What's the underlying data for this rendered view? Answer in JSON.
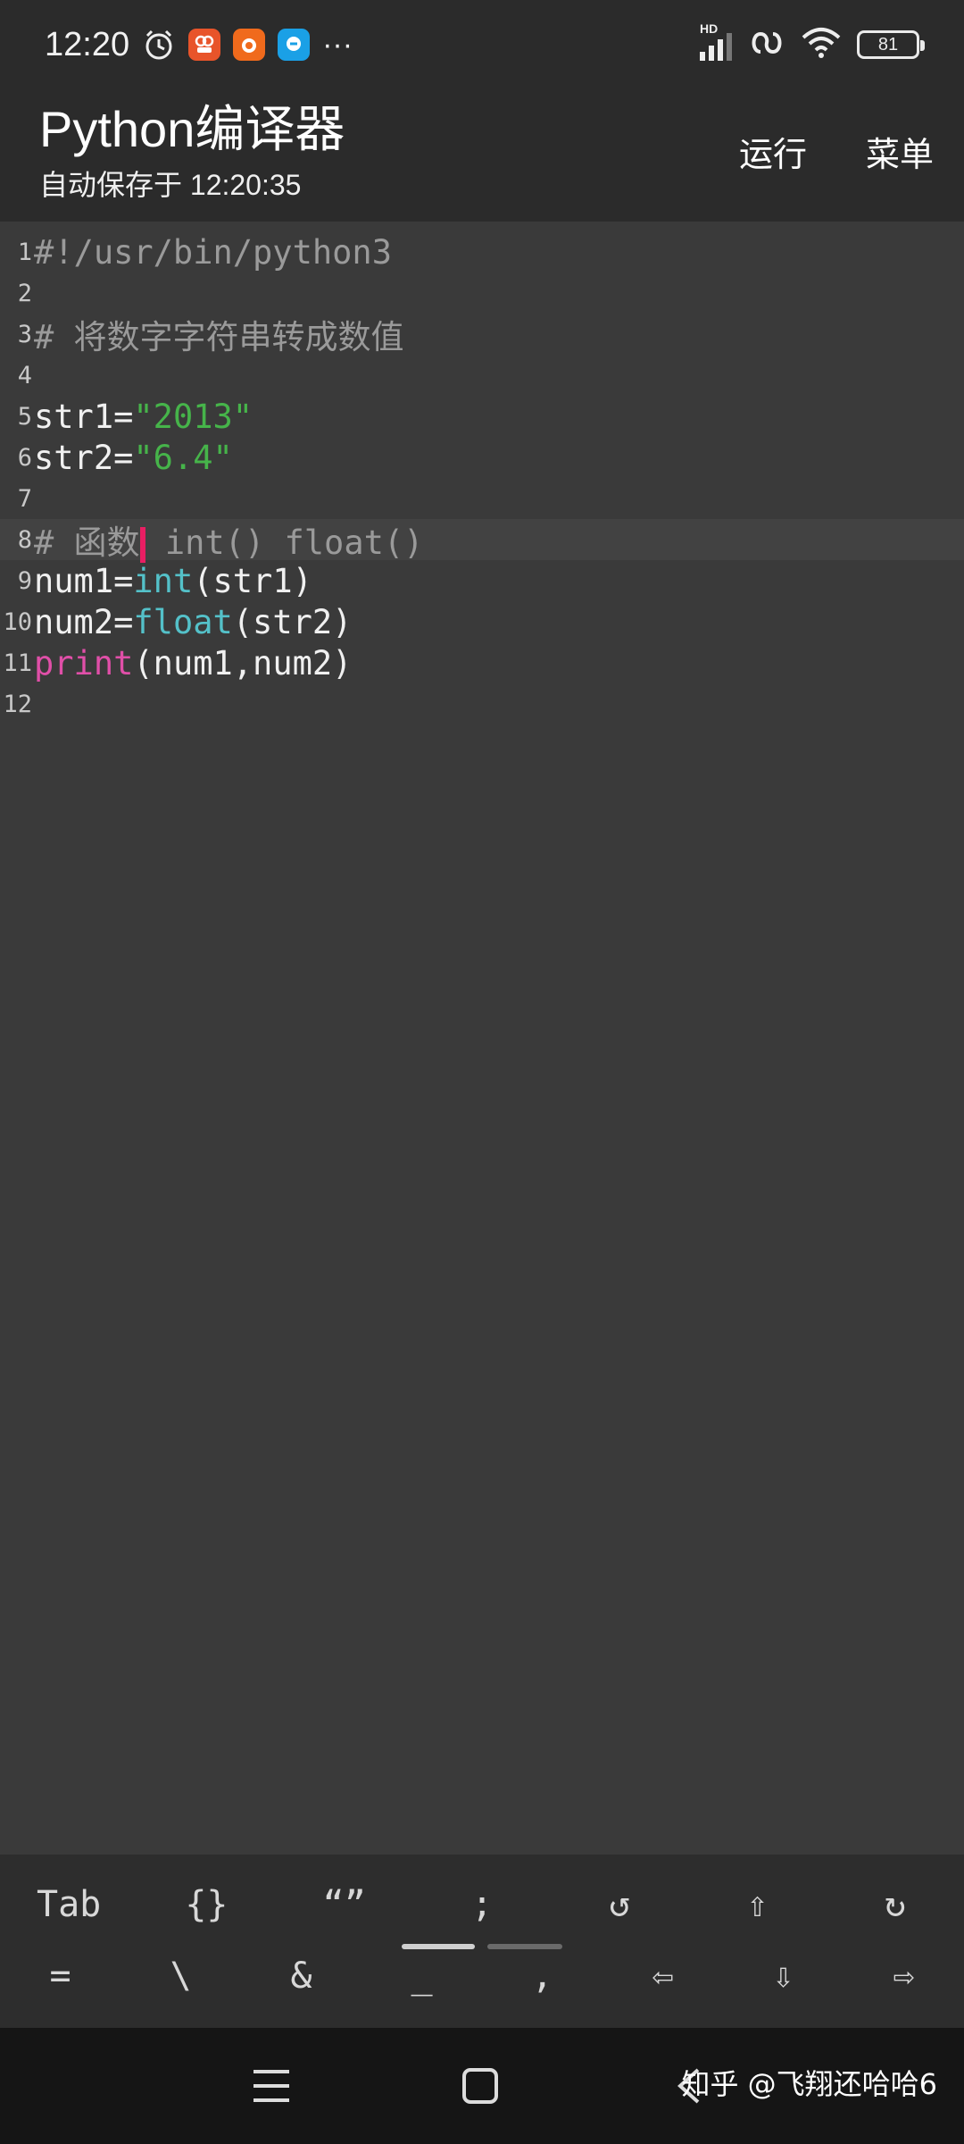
{
  "status_bar": {
    "time": "12:20",
    "more_dots": "···",
    "battery_level": "81",
    "network_badge": "HD",
    "app_icons": [
      "alarm-icon",
      "app-badge-orange",
      "app-badge-orange-2",
      "app-badge-blue"
    ]
  },
  "app_bar": {
    "title": "Python编译器",
    "subtitle": "自动保存于 12:20:35",
    "run_label": "运行",
    "menu_label": "菜单"
  },
  "editor": {
    "current_line": 8,
    "lines": [
      {
        "no": "1",
        "segments": [
          {
            "t": "#!/usr/bin/python3",
            "c": "comment"
          }
        ]
      },
      {
        "no": "2",
        "segments": []
      },
      {
        "no": "3",
        "segments": [
          {
            "t": "# 将数字字符串转成数值",
            "c": "comment"
          }
        ]
      },
      {
        "no": "4",
        "segments": []
      },
      {
        "no": "5",
        "segments": [
          {
            "t": "str1=",
            "c": "plain"
          },
          {
            "t": "\"2013\"",
            "c": "string"
          }
        ]
      },
      {
        "no": "6",
        "segments": [
          {
            "t": "str2=",
            "c": "plain"
          },
          {
            "t": "\"6.4\"",
            "c": "string"
          }
        ]
      },
      {
        "no": "7",
        "segments": []
      },
      {
        "no": "8",
        "segments": [
          {
            "t": "# 函数",
            "c": "comment"
          },
          {
            "t": "",
            "c": "caret"
          },
          {
            "t": " int() float()",
            "c": "comment"
          }
        ]
      },
      {
        "no": "9",
        "segments": [
          {
            "t": "num1=",
            "c": "plain"
          },
          {
            "t": "int",
            "c": "builtin"
          },
          {
            "t": "(str1)",
            "c": "plain"
          }
        ]
      },
      {
        "no": "10",
        "segments": [
          {
            "t": "num2=",
            "c": "plain"
          },
          {
            "t": "float",
            "c": "builtin"
          },
          {
            "t": "(str2)",
            "c": "plain"
          }
        ]
      },
      {
        "no": "11",
        "segments": [
          {
            "t": "print",
            "c": "keyword"
          },
          {
            "t": "(num1,num2)",
            "c": "plain"
          }
        ]
      },
      {
        "no": "12",
        "segments": []
      }
    ]
  },
  "helper_keys": {
    "row1": [
      "Tab",
      "{}",
      "“”",
      ";",
      "↺",
      "⇧",
      "↻"
    ],
    "row2": [
      "=",
      "\\",
      "&",
      "_",
      ",",
      "⇦",
      "⇩",
      "⇨"
    ]
  },
  "nav": {
    "menu_icon": "☰",
    "home_icon": "▢",
    "back_icon": "〈"
  },
  "watermark": "知乎 @飞翔还哈哈6"
}
